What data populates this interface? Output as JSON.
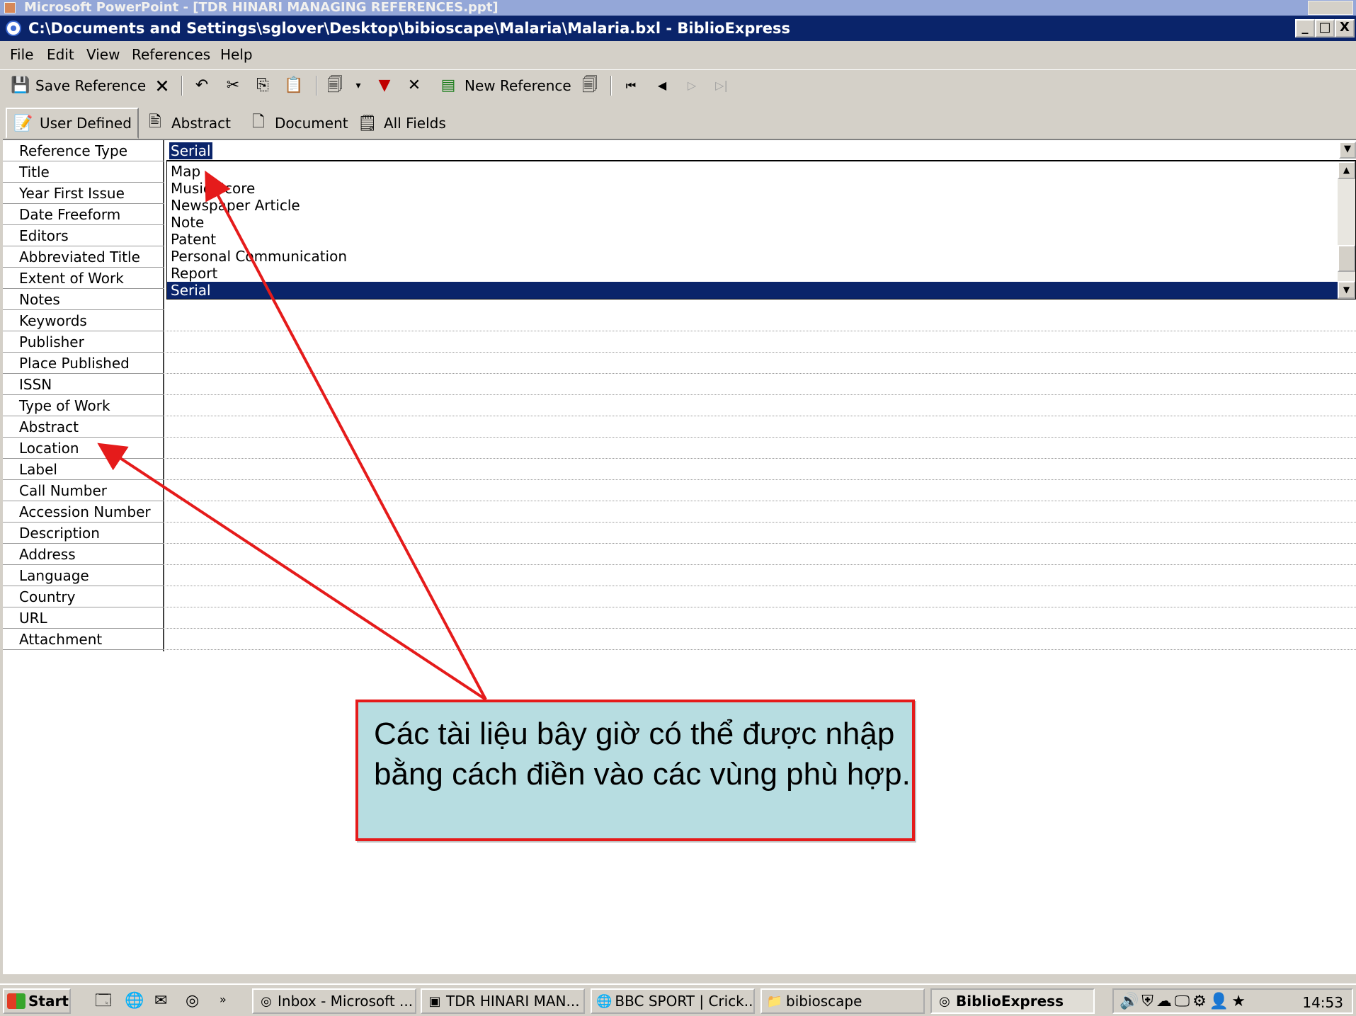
{
  "background_window": {
    "title": "Microsoft PowerPoint - [TDR HINARI MANAGING REFERENCES.ppt]"
  },
  "window": {
    "title": "C:\\Documents and Settings\\sglover\\Desktop\\bibioscape\\Malaria\\Malaria.bxl - BiblioExpress",
    "minimize": "_",
    "maximize": "□",
    "close": "X"
  },
  "menu": [
    "File",
    "Edit",
    "View",
    "References",
    "Help"
  ],
  "toolbar": {
    "save_label": "Save Reference",
    "new_label": "New Reference",
    "icons": [
      "save-icon",
      "delete-reference-icon",
      "undo-icon",
      "cut-icon",
      "copy-icon",
      "paste-icon",
      "format-icon",
      "dropdown-arrow-icon",
      "flag-icon",
      "cancel-icon",
      "new-reference-icon",
      "duplicate-icon",
      "first-record-icon",
      "previous-record-icon",
      "next-record-icon",
      "last-record-icon"
    ]
  },
  "tabs": [
    "User Defined",
    "Abstract",
    "Document",
    "All Fields"
  ],
  "fields": [
    "Reference Type",
    "Title",
    "Year First Issue",
    "Date Freeform",
    "Editors",
    "Abbreviated Title",
    "Extent of Work",
    "Notes",
    "Keywords",
    "Publisher",
    "Place Published",
    "ISSN",
    "Type of Work",
    "Abstract",
    "Location",
    "Label",
    "Call Number",
    "Accession Number",
    "Description",
    "Address",
    "Language",
    "Country",
    "URL",
    "Attachment"
  ],
  "reference_type": {
    "value": "Serial",
    "options": [
      "Map",
      "Music Score",
      "Newspaper Article",
      "Note",
      "Patent",
      "Personal Communication",
      "Report",
      "Serial"
    ],
    "selected_index": 7
  },
  "callout": {
    "text": "Các tài liệu bây giờ có thể được nhập bằng cách điền vào các vùng phù hợp."
  },
  "colors": {
    "annotation": "#e51b1b",
    "callout_fill": "#b7dde1",
    "selection": "#0a246a"
  },
  "taskbar": {
    "start": "Start",
    "tasks": [
      "Inbox - Microsoft ...",
      "TDR HINARI MAN...",
      "BBC SPORT | Crick...",
      "bibioscape",
      "BiblioExpress"
    ],
    "active_task": "BiblioExpress",
    "clock": "14:53"
  }
}
